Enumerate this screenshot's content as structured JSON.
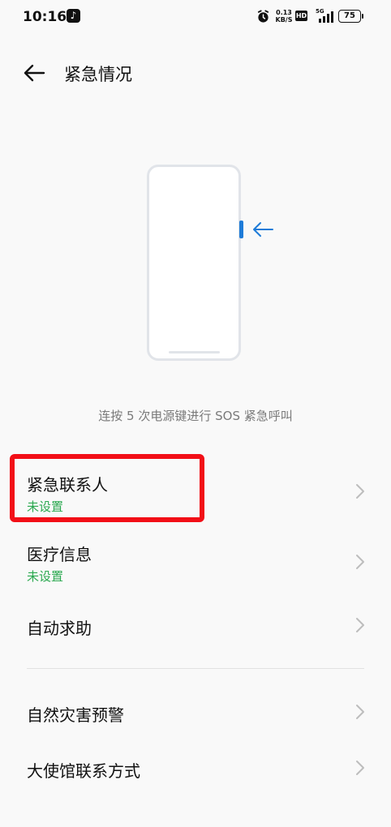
{
  "status_bar": {
    "time": "10:16",
    "net_speed_value": "0.13",
    "net_speed_unit": "KB/S",
    "hd_label": "HD",
    "network_type": "5G",
    "battery_level": "75"
  },
  "header": {
    "title": "紧急情况"
  },
  "illustration": {
    "accent_color": "#1e7bd8",
    "instruction": "连按 5 次电源键进行 SOS 紧急呼叫"
  },
  "list": {
    "emergency_contacts": {
      "title": "紧急联系人",
      "status": "未设置"
    },
    "medical_info": {
      "title": "医疗信息",
      "status": "未设置"
    },
    "auto_help": {
      "title": "自动求助"
    },
    "disaster_warning": {
      "title": "自然灾害预警"
    },
    "embassy_contact": {
      "title": "大使馆联系方式"
    }
  },
  "colors": {
    "status_green": "#2aa84f",
    "highlight_red": "#f20f17"
  }
}
